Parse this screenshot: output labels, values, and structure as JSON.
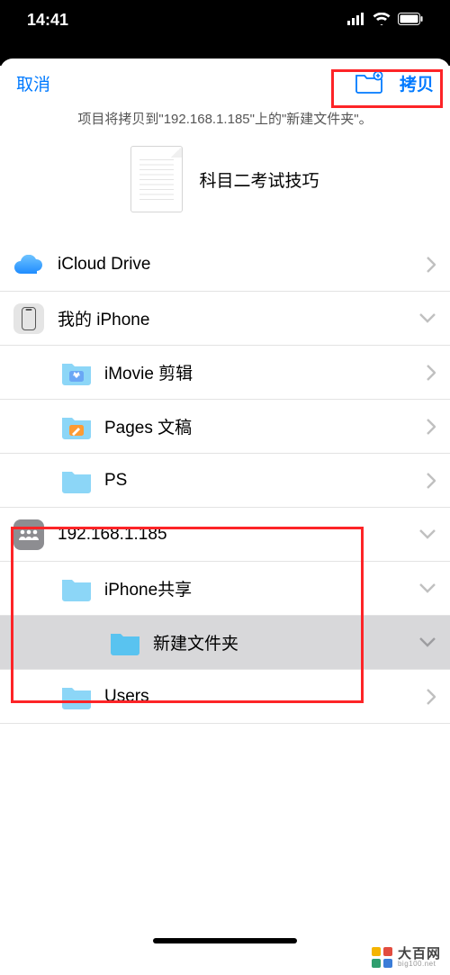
{
  "status": {
    "time": "14:41"
  },
  "header": {
    "cancel": "取消",
    "copy": "拷贝"
  },
  "subtitle": "项目将拷贝到\"192.168.1.185\"上的\"新建文件夹\"。",
  "file": {
    "name": "科目二考试技巧"
  },
  "rows": {
    "icloud": "iCloud Drive",
    "iphone": "我的 iPhone",
    "imovie": "iMovie 剪辑",
    "pages": "Pages 文稿",
    "ps": "PS",
    "server": "192.168.1.185",
    "share": "iPhone共享",
    "newfolder": "新建文件夹",
    "users": "Users"
  },
  "watermark": {
    "name": "大百网",
    "url": "big100.net"
  },
  "colors": {
    "folder_light": "#8cd6f7",
    "folder_dark": "#59c3f0",
    "imovie_bg": "#6aa7f5",
    "pages_bg": "#ff9b33",
    "accent": "#007aff",
    "highlight": "#fd2427"
  }
}
